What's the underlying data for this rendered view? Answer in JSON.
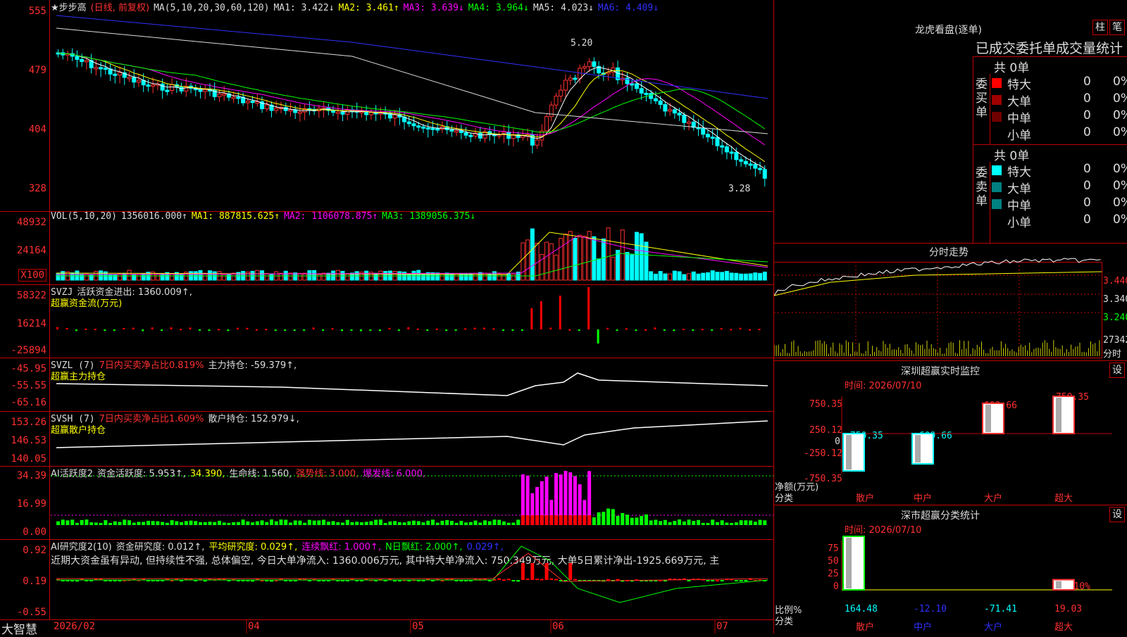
{
  "kline": {
    "title": "★步步高",
    "period": "(日线, 前复权)",
    "ma_label": "MA(5,10,20,30,60,120)",
    "ma1": "MA1: 3.422↓",
    "ma2": "MA2: 3.461↑",
    "ma3": "MA3: 3.639↓",
    "ma4": "MA4: 3.964↓",
    "ma5": "MA5: 4.023↓",
    "ma6": "MA6: 4.409↓",
    "y_ticks": [
      "555",
      "479",
      "404",
      "328"
    ],
    "high_marker": "5.20",
    "low_marker": "3.28"
  },
  "vol": {
    "label": "VOL(5,10,20)",
    "value": "1356016.000↑",
    "ma1": "MA1: 887815.625↑",
    "ma2": "MA2: 1106078.875↑",
    "ma3": "MA3: 1389056.375↓",
    "y_ticks": [
      "48932",
      "24164"
    ],
    "unit": "X100"
  },
  "svzj": {
    "label": "SVZJ",
    "text": "活跃资金进出: 1360.009↑,",
    "subtitle": "超赢资金流(万元)",
    "y_ticks": [
      "58322",
      "16214",
      "-25894"
    ]
  },
  "svzl": {
    "label": "SVZL (7)",
    "text1": "7日内买卖净占比0.819%",
    "text2": "主力持仓: -59.379↑,",
    "subtitle": "超赢主力持仓",
    "y_ticks": [
      "-45.95",
      "-55.55",
      "-65.16"
    ]
  },
  "svsh": {
    "label": "SVSH (7)",
    "text1": "7日内买卖净占比1.609%",
    "text2": "散户持仓: 152.979↓,",
    "subtitle": "超赢散户持仓",
    "y_ticks": [
      "153.26",
      "146.53",
      "140.05"
    ]
  },
  "ai1": {
    "label": "AI活跃度2",
    "t1": "资金活跃度: 5.953↑,",
    "t2": "34.390,",
    "t3": "生命线: 1.560,",
    "t4": "强势线: 3.000,",
    "t5": "爆发线: 6.000,",
    "y_ticks": [
      "34.39",
      "16.99",
      "0.00"
    ]
  },
  "ai2": {
    "label": "AI研究度2(10)",
    "t1": "资金研究度: 0.012↑,",
    "t2": "平均研究度: 0.029↑,",
    "t3": "连续飘红: 1.000↑,",
    "t4": "N日飘红: 2.000↑,",
    "t5": "0.029↑,",
    "comment": "近期大资金虽有异动, 但持续性不强, 总体偏空, 今日大单净流入: 1360.006万元, 其中特大单净流入: 750.349万元, 大单5日累计净出-1925.669万元, 主",
    "y_ticks": [
      "0.92",
      "0.19",
      "-0.55"
    ]
  },
  "x_axis": [
    "2026/02",
    "04",
    "05",
    "06",
    "07"
  ],
  "brand": "大智慧",
  "dragon": {
    "title": "龙虎看盘(逐单)",
    "btn1": "柱",
    "btn2": "笔",
    "tabs": "已成交委托单成交量统计",
    "buy_group": "委买单",
    "sell_group": "委卖单",
    "buy_total": "共 0单",
    "sell_total": "共 0单",
    "buy_rows": [
      {
        "label": "特大",
        "value": "0",
        "pct": "0%",
        "color": "#ff0000"
      },
      {
        "label": "大单",
        "value": "0",
        "pct": "0%",
        "color": "#a00000"
      },
      {
        "label": "中单",
        "value": "0",
        "pct": "0%",
        "color": "#700000"
      },
      {
        "label": "小单",
        "value": "0",
        "pct": "0%",
        "color": "#000000"
      }
    ],
    "sell_rows": [
      {
        "label": "特大",
        "value": "0",
        "pct": "0%",
        "color": "#00ffff"
      },
      {
        "label": "大单",
        "value": "0",
        "pct": "0%",
        "color": "#008080"
      },
      {
        "label": "中单",
        "value": "0",
        "pct": "0%",
        "color": "#008080"
      },
      {
        "label": "小单",
        "value": "0",
        "pct": "0%",
        "color": "#000000"
      }
    ]
  },
  "fenshi": {
    "title": "分时走势",
    "y_ticks": [
      "3.440",
      "3.340",
      "3.240"
    ],
    "vol_tick": "27342",
    "footer": "分时"
  },
  "monitor": {
    "title": "深圳超赢实时监控",
    "btn": "设",
    "time": "时间: 2026/07/10",
    "y_ticks": [
      "750.35",
      "250.12",
      "0",
      "-250.12",
      "-750.35"
    ],
    "y_title": "净额(万元)",
    "x_title": "分类",
    "bars": [
      {
        "name": "散户",
        "value": -750.35,
        "label": "-750.35"
      },
      {
        "name": "中户",
        "value": -609.66,
        "label": "-609.66"
      },
      {
        "name": "大户",
        "value": 609.66,
        "label": "609.66"
      },
      {
        "name": "超大",
        "value": 750.35,
        "label": "750.35"
      }
    ]
  },
  "classify": {
    "title": "深市超赢分类统计",
    "btn": "设",
    "time": "时间: 2026/07/10",
    "y_ticks": [
      "75",
      "50",
      "25",
      "0"
    ],
    "y_title": "比例%",
    "x_title": "分类",
    "extra_label": "+0.10%",
    "bars": [
      {
        "name": "散户",
        "value": 164.48,
        "label": "164.48",
        "height_pct": 100
      },
      {
        "name": "中户",
        "value": -12.1,
        "label": "-12.10",
        "height_pct": 0
      },
      {
        "name": "大户",
        "value": -71.41,
        "label": "-71.41",
        "height_pct": 0
      },
      {
        "name": "超大",
        "value": 19.03,
        "label": "19.03",
        "height_pct": 19
      }
    ]
  },
  "chart_data": {
    "type": "bar",
    "title": "深圳超赢实时监控",
    "categories": [
      "散户",
      "中户",
      "大户",
      "超大"
    ],
    "values": [
      -750.35,
      -609.66,
      609.66,
      750.35
    ],
    "ylabel": "净额(万元)",
    "xlabel": "分类",
    "ylim": [
      -750.35,
      750.35
    ]
  }
}
